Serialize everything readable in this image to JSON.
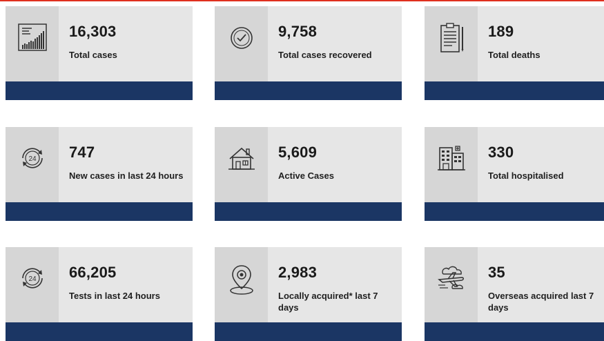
{
  "cards": [
    {
      "value": "16,303",
      "label": "Total cases",
      "icon": "bar-chart-icon"
    },
    {
      "value": "9,758",
      "label": "Total cases recovered",
      "icon": "check-circle-icon"
    },
    {
      "value": "189",
      "label": "Total deaths",
      "icon": "clipboard-icon"
    },
    {
      "value": "747",
      "label": "New cases in last 24 hours",
      "icon": "24-hours-icon"
    },
    {
      "value": "5,609",
      "label": "Active Cases",
      "icon": "house-icon"
    },
    {
      "value": "330",
      "label": "Total hospitalised",
      "icon": "hospital-icon"
    },
    {
      "value": "66,205",
      "label": "Tests in last 24 hours",
      "icon": "24-hours-icon"
    },
    {
      "value": "2,983",
      "label": "Locally acquired* last 7 days",
      "icon": "location-pin-icon"
    },
    {
      "value": "35",
      "label": "Overseas acquired last 7 days",
      "icon": "airplane-icon"
    }
  ],
  "colors": {
    "card_bg": "#e6e6e6",
    "icon_bg": "#d6d6d6",
    "bar": "#1b3664",
    "accent_rule": "#e0301e"
  }
}
